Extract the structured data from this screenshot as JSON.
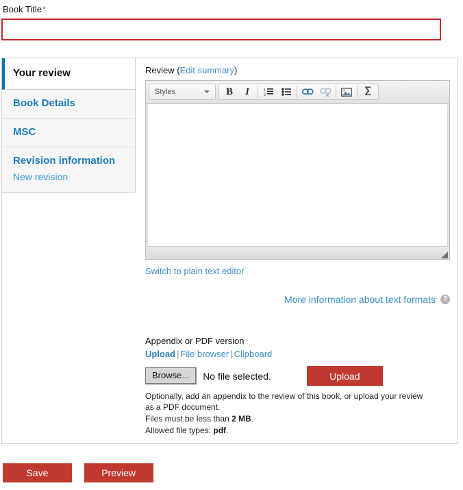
{
  "form": {
    "title_field": {
      "label": "Book Title",
      "required_mark": "*",
      "value": "",
      "placeholder": ""
    }
  },
  "vertical_tabs": [
    {
      "title": "Your review",
      "sub": "",
      "active": true
    },
    {
      "title": "Book Details",
      "sub": "",
      "active": false
    },
    {
      "title": "MSC",
      "sub": "",
      "active": false
    },
    {
      "title": "Revision information",
      "sub": "New revision",
      "active": false
    }
  ],
  "review_pane": {
    "label_prefix": "Review (",
    "edit_summary_link": "Edit summary",
    "label_suffix": ")",
    "editor": {
      "styles_combo": "Styles",
      "buttons": [
        {
          "name": "bold-icon",
          "glyph": "B"
        },
        {
          "name": "italic-icon",
          "glyph": "I"
        },
        {
          "name": "numbered-list-icon",
          "glyph": ""
        },
        {
          "name": "bulleted-list-icon",
          "glyph": ""
        },
        {
          "name": "link-icon",
          "glyph": ""
        },
        {
          "name": "unlink-icon",
          "glyph": ""
        },
        {
          "name": "image-icon",
          "glyph": ""
        },
        {
          "name": "math-sigma-icon",
          "glyph": "Σ"
        }
      ],
      "content": ""
    },
    "switch_editor_link": "Switch to plain text editor",
    "text_formats_link": "More information about text formats",
    "help_icon_glyph": "?"
  },
  "appendix": {
    "label": "Appendix or PDF version",
    "tabs": {
      "upload": "Upload",
      "file_browser": "File browser",
      "clipboard": "Clipboard",
      "separator": "|"
    },
    "browse_button": "Browse...",
    "file_status": "No file selected.",
    "upload_button": "Upload",
    "help_main": "Optionally, add an appendix to the review of this book, or upload your review as a PDF document.",
    "help_size_prefix": "Files must be less than ",
    "help_size_value": "2 MB",
    "help_size_suffix": ".",
    "help_types_prefix": "Allowed file types: ",
    "help_types_value": "pdf",
    "help_types_suffix": "."
  },
  "actions": {
    "save": "Save",
    "preview": "Preview"
  },
  "colors": {
    "required_red": "#c1272d",
    "button_red": "#c0392f",
    "link_blue": "#3a8fd0",
    "tab_blue": "#1a7bbd",
    "active_tab_accent": "#0c72b0"
  }
}
